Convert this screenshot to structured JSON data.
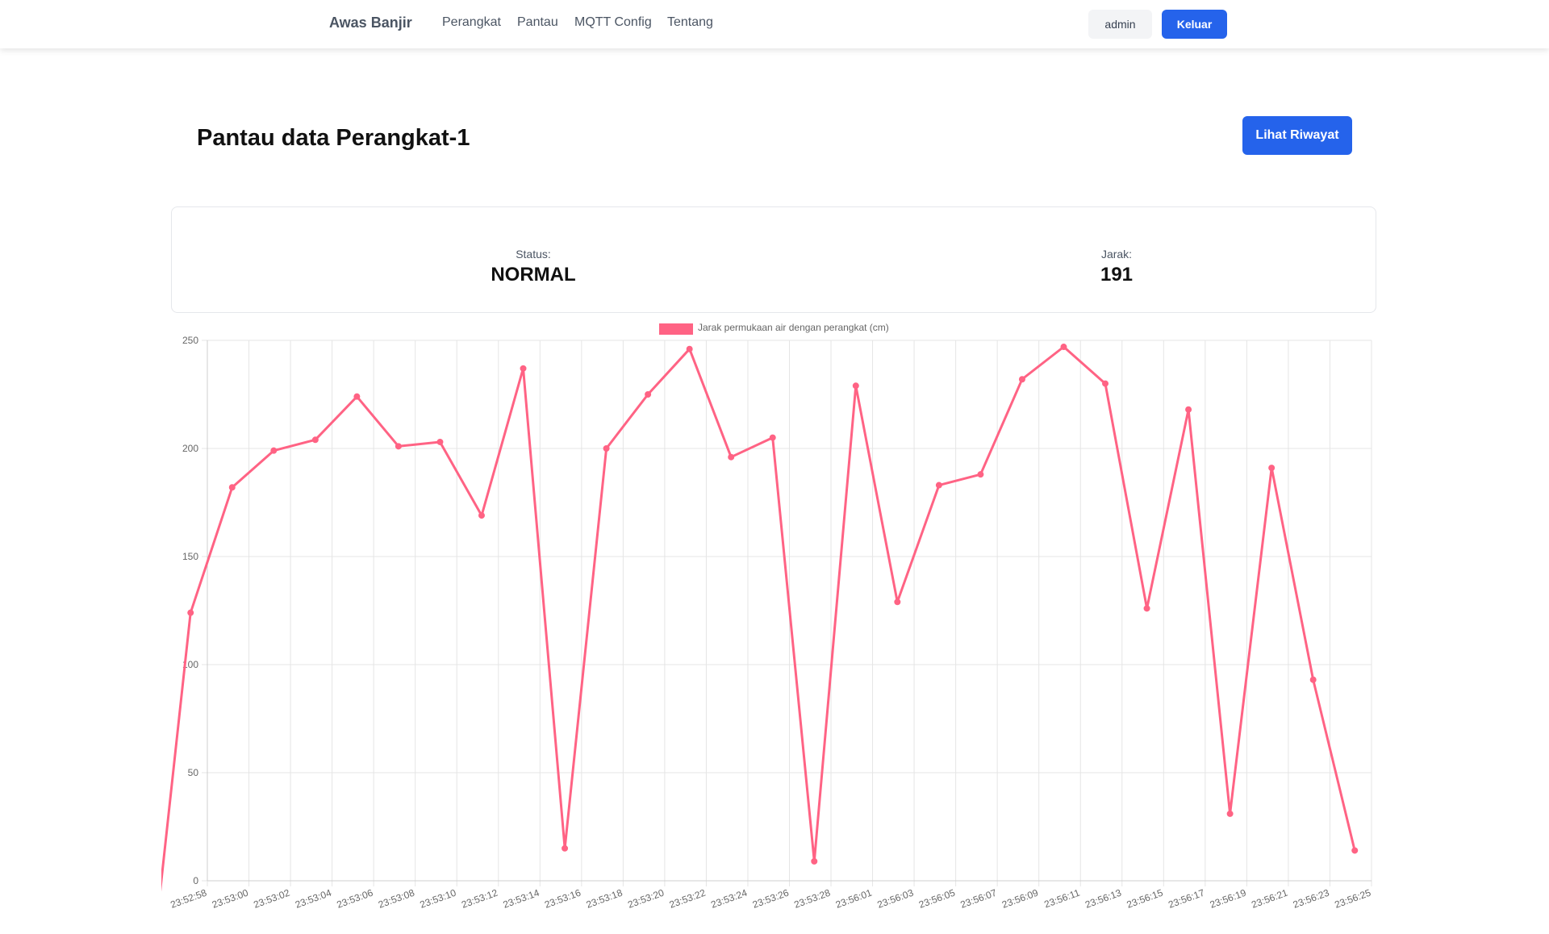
{
  "navbar": {
    "brand": "Awas Banjir",
    "links": [
      "Perangkat",
      "Pantau",
      "MQTT Config",
      "Tentang"
    ],
    "user": "admin",
    "logout_label": "Keluar"
  },
  "page": {
    "title": "Pantau data Perangkat-1",
    "history_button": "Lihat Riwayat"
  },
  "status": {
    "status_label": "Status:",
    "status_value": "NORMAL",
    "distance_label": "Jarak:",
    "distance_value": "191"
  },
  "colors": {
    "accent": "#2563eb",
    "series": "#ff6384",
    "grid": "#e5e5e5"
  },
  "chart_data": {
    "type": "line",
    "legend_position": "top",
    "grid": true,
    "ylim": [
      0,
      250
    ],
    "yticks": [
      0,
      50,
      100,
      150,
      200,
      250
    ],
    "x": [
      "23:52:58",
      "23:53:00",
      "23:53:02",
      "23:53:04",
      "23:53:06",
      "23:53:08",
      "23:53:10",
      "23:53:12",
      "23:53:14",
      "23:53:16",
      "23:53:18",
      "23:53:20",
      "23:53:22",
      "23:53:24",
      "23:53:26",
      "23:53:28",
      "23:56:01",
      "23:56:03",
      "23:56:05",
      "23:56:07",
      "23:56:09",
      "23:56:11",
      "23:56:13",
      "23:56:15",
      "23:56:17",
      "23:56:19",
      "23:56:21",
      "23:56:23",
      "23:56:25"
    ],
    "series": [
      {
        "name": "Jarak permukaan air dengan perangkat (cm)",
        "values": [
          124,
          182,
          199,
          204,
          224,
          201,
          203,
          169,
          237,
          15,
          200,
          225,
          246,
          196,
          205,
          9,
          229,
          129,
          183,
          188,
          232,
          247,
          230,
          126,
          218,
          31,
          191,
          93,
          14
        ]
      }
    ]
  }
}
